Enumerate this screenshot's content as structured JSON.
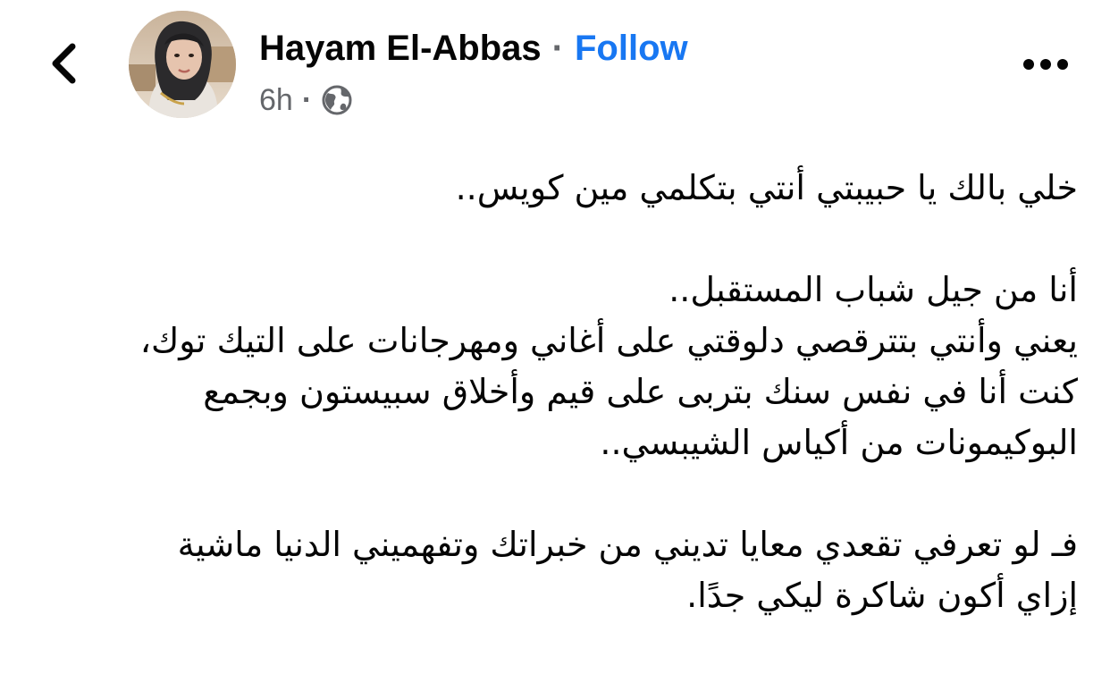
{
  "header": {
    "back_icon": "chevron-left-icon",
    "author_name": "Hayam El-Abbas",
    "separator": "·",
    "follow_label": "Follow",
    "time_ago": "6h",
    "meta_separator": "·",
    "audience_icon": "globe-icon",
    "more_icon": "more-horizontal-icon"
  },
  "post": {
    "paragraphs": [
      [
        "خلي بالك يا حبيبتي أنتي بتكلمي مين كويس.."
      ],
      [
        "أنا من جيل شباب المستقبل..",
        "يعني وأنتي بتترقصي دلوقتي على أغاني ومهرجانات على التيك توك،",
        "كنت أنا في نفس سنك بتربى على قيم وأخلاق سبيستون وبجمع",
        "البوكيمونات من أكياس الشيبسي.."
      ],
      [
        "فـ لو تعرفي تقعدي معايا تديني من خبراتك وتفهميني الدنيا ماشية",
        "إزاي أكون شاكرة ليكي جدًا."
      ]
    ]
  },
  "colors": {
    "link": "#1877f2",
    "secondary_text": "#65676b",
    "primary_text": "#050505"
  }
}
